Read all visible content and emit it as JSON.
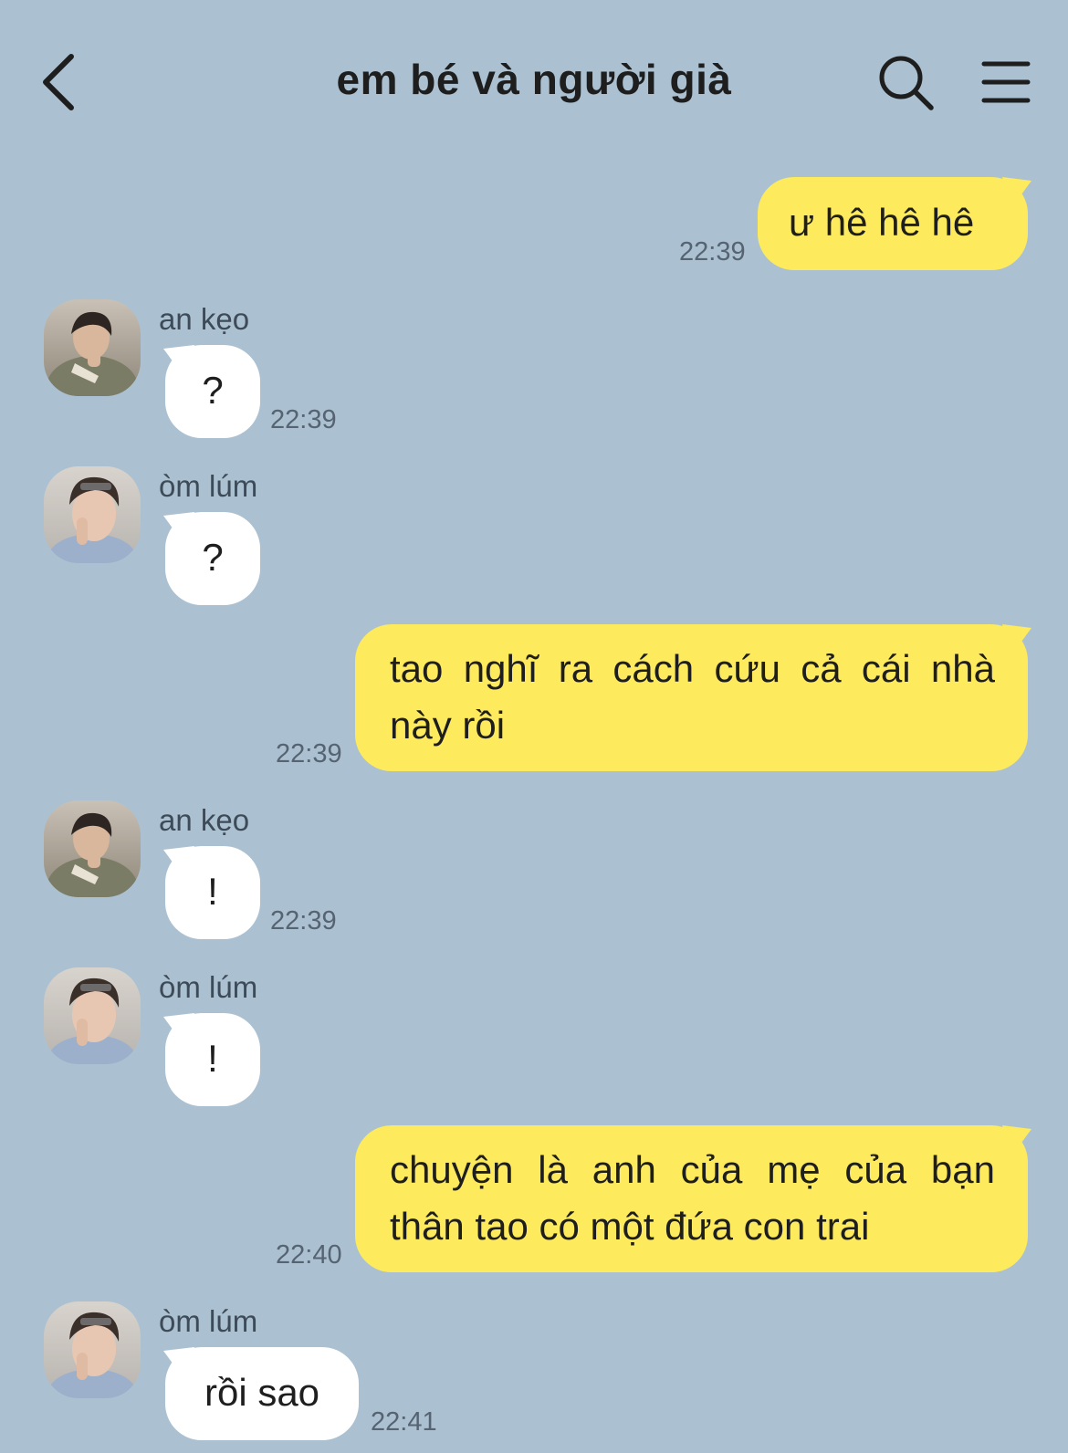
{
  "header": {
    "title": "em bé và người già"
  },
  "messages": [
    {
      "from": "me",
      "text": "ư hê hê hê",
      "time": "22:39"
    },
    {
      "from": "other",
      "sender": "an kẹo",
      "text": "?",
      "time": "22:39"
    },
    {
      "from": "other",
      "sender": "òm lúm",
      "text": "?"
    },
    {
      "from": "me",
      "text": "tao nghĩ ra cách cứu cả cái nhà này rồi",
      "time": "22:39"
    },
    {
      "from": "other",
      "sender": "an kẹo",
      "text": "!",
      "time": "22:39"
    },
    {
      "from": "other",
      "sender": "òm lúm",
      "text": "!"
    },
    {
      "from": "me",
      "text": "chuyện là anh của mẹ của bạn thân tao có một đứa con trai",
      "time": "22:40"
    },
    {
      "from": "other",
      "sender": "òm lúm",
      "text": "rồi sao",
      "time": "22:41"
    }
  ],
  "icons": {
    "back": "chevron-left-icon",
    "search": "search-icon",
    "menu": "hamburger-menu-icon"
  },
  "colors": {
    "background": "#abc1d1",
    "my_bubble": "#fdea5d",
    "their_bubble": "#ffffff"
  }
}
